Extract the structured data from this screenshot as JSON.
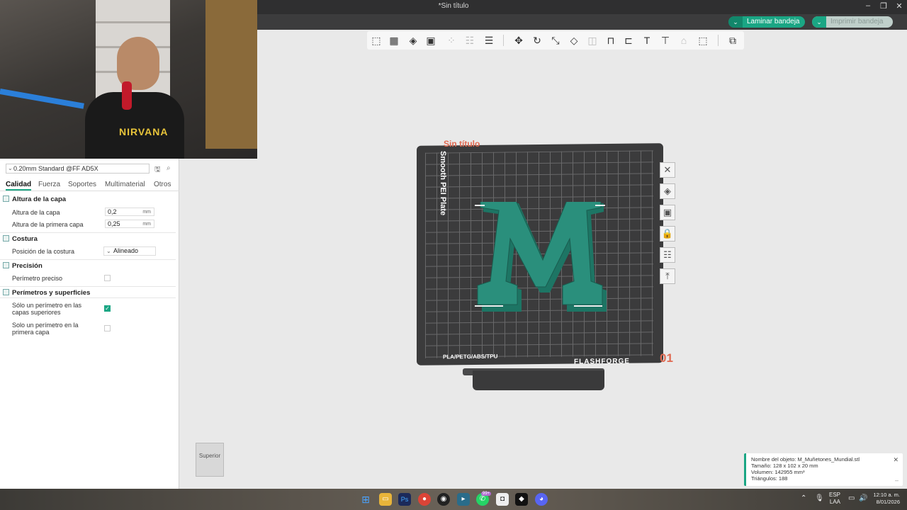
{
  "window": {
    "title": "*Sin título"
  },
  "topbar": {
    "slice_label": "Laminar bandeja",
    "print_label": "Imprimir bandeja"
  },
  "webcam": {
    "shirt_text": "NIRVANA"
  },
  "left_panel": {
    "preset": "0.20mm Standard @FF AD5X",
    "tabs": [
      "Calidad",
      "Fuerza",
      "Soportes",
      "Multimaterial",
      "Otros"
    ],
    "active_tab": "Calidad",
    "sections": {
      "layer_height": {
        "title": "Altura de la capa",
        "layer_height_label": "Altura de la capa",
        "layer_height_value": "0,2",
        "first_layer_label": "Altura de la primera capa",
        "first_layer_value": "0,25",
        "unit": "mm"
      },
      "seam": {
        "title": "Costura",
        "position_label": "Posición de la costura",
        "position_value": "Alineado"
      },
      "precision": {
        "title": "Precisión",
        "precise_wall_label": "Perímetro preciso",
        "precise_wall_checked": false
      },
      "walls": {
        "title": "Perímetros y superficies",
        "one_wall_top_label": "Sólo un perímetro en las capas superiores",
        "one_wall_top_checked": true,
        "one_wall_first_label": "Solo un perímetro en la primera capa",
        "one_wall_first_checked": false
      }
    }
  },
  "plate": {
    "name": "Sin título",
    "vertical_text": "Smooth PEI Plate",
    "material_text": "PLA/PETG/ABS/TPU",
    "brand": "FLASHFORGE",
    "number": "01",
    "model_letter": "M",
    "model_color": "#2a8f7c"
  },
  "view_cube": {
    "label": "Superior"
  },
  "object_info": {
    "name": "Nombre del objeto: M_Muñetones_Mundial.stl",
    "size": "Tamaño: 128 x 102 x 20 mm",
    "volume": "Volumen: 142955 mm³",
    "triangles": "Triángulos: 188"
  },
  "taskbar": {
    "lang_top": "ESP",
    "lang_bottom": "LAA",
    "time": "12:10 a. m.",
    "date": "8/01/2026",
    "badge_whatsapp": "99+"
  },
  "colors": {
    "accent": "#1aa684",
    "plate": "#3b3b3c",
    "title_red": "#e06a52"
  }
}
